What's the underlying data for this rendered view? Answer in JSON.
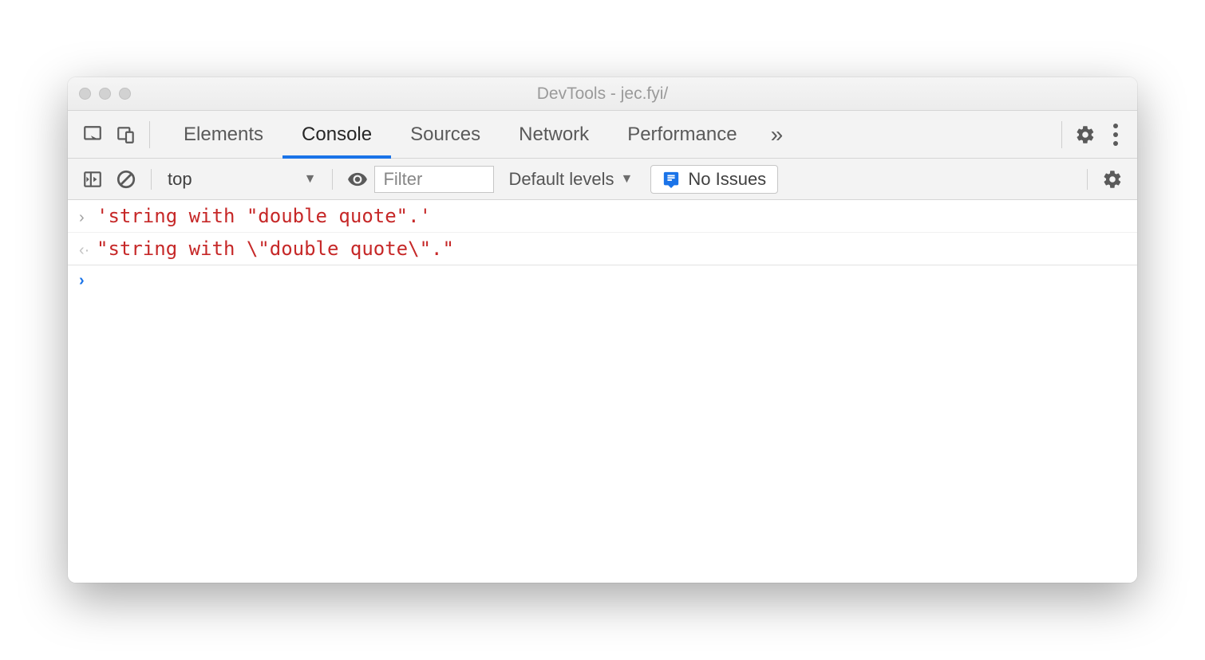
{
  "window": {
    "title": "DevTools - jec.fyi/"
  },
  "tabs": {
    "items": [
      "Elements",
      "Console",
      "Sources",
      "Network",
      "Performance"
    ],
    "active_index": 1
  },
  "toolbar": {
    "context": "top",
    "filter_placeholder": "Filter",
    "levels_label": "Default levels",
    "issues_label": "No Issues"
  },
  "console": {
    "entries": [
      {
        "dir": "in",
        "text": "'string with \"double quote\".'"
      },
      {
        "dir": "out",
        "text": "\"string with \\\"double quote\\\".\""
      }
    ]
  }
}
